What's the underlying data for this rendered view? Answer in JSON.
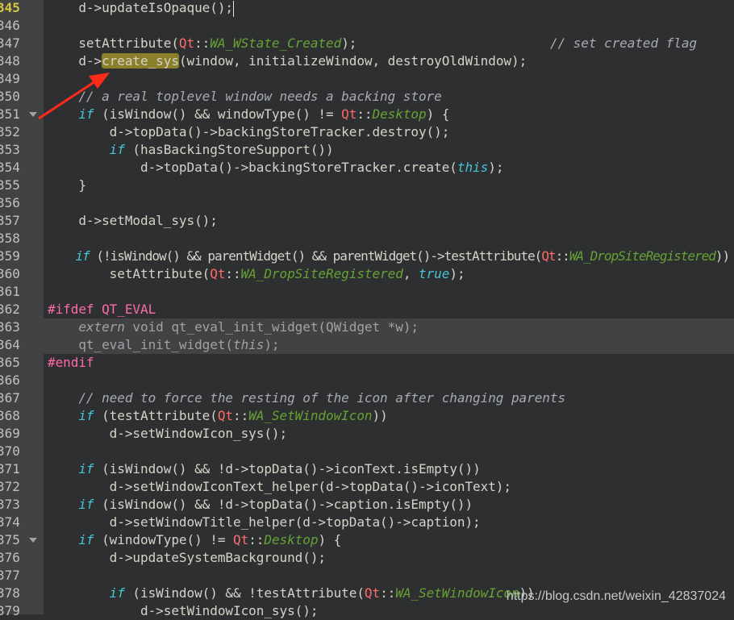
{
  "editor": {
    "current_line": 345,
    "colors": {
      "background": "#2e2f30",
      "gutter": "#404244",
      "keyword": "#45c6d6",
      "qt_namespace": "#ff6a6a",
      "enum": "#66a334",
      "comment": "#a8abb0",
      "preprocessor": "#ff6aad",
      "search_highlight": "#8a7f2a",
      "annotation_arrow": "#ff2a1a"
    },
    "lines": [
      {
        "n": "345",
        "segs": [
          [
            "",
            "    d->updateIsOpaque();"
          ]
        ],
        "cursor": true
      },
      {
        "n": "346",
        "segs": []
      },
      {
        "n": "347",
        "segs": [
          [
            "",
            "    setAttribute("
          ],
          [
            "qt",
            "Qt"
          ],
          [
            "",
            "::"
          ],
          [
            "enum",
            "WA_WState_Created"
          ],
          [
            "",
            ");                         "
          ],
          [
            "cm",
            "// set created flag"
          ]
        ]
      },
      {
        "n": "348",
        "segs": [
          [
            "",
            "    d->"
          ],
          [
            "hl",
            "create_sys"
          ],
          [
            "",
            "(window, initializeWindow, destroyOldWindow);"
          ]
        ]
      },
      {
        "n": "349",
        "segs": []
      },
      {
        "n": "350",
        "segs": [
          [
            "cm",
            "    // a real toplevel window needs a backing store"
          ]
        ]
      },
      {
        "n": "351",
        "fold": true,
        "segs": [
          [
            "",
            "    "
          ],
          [
            "kw",
            "if"
          ],
          [
            "",
            " (isWindow() && windowType() != "
          ],
          [
            "qt",
            "Qt"
          ],
          [
            "",
            "::"
          ],
          [
            "enum",
            "Desktop"
          ],
          [
            "",
            ") {"
          ]
        ]
      },
      {
        "n": "352",
        "segs": [
          [
            "",
            "        d->topData()->backingStoreTracker.destroy();"
          ]
        ]
      },
      {
        "n": "353",
        "segs": [
          [
            "",
            "        "
          ],
          [
            "kw",
            "if"
          ],
          [
            "",
            " (hasBackingStoreSupport())"
          ]
        ]
      },
      {
        "n": "354",
        "segs": [
          [
            "",
            "            d->topData()->backingStoreTracker.create("
          ],
          [
            "kw",
            "this"
          ],
          [
            "",
            ");"
          ]
        ]
      },
      {
        "n": "355",
        "segs": [
          [
            "",
            "    }"
          ]
        ]
      },
      {
        "n": "356",
        "segs": []
      },
      {
        "n": "357",
        "segs": [
          [
            "",
            "    d->setModal_sys();"
          ]
        ]
      },
      {
        "n": "358",
        "segs": []
      },
      {
        "n": "359",
        "segs": [
          [
            "",
            "    "
          ],
          [
            "kw",
            "if"
          ],
          [
            "",
            " (!isWindow() && parentWidget() && parentWidget()->testAttribute("
          ],
          [
            "qt",
            "Qt"
          ],
          [
            "",
            "::"
          ],
          [
            "enum",
            "WA_DropSiteRegistered"
          ],
          [
            "",
            "))"
          ]
        ]
      },
      {
        "n": "360",
        "segs": [
          [
            "",
            "        setAttribute("
          ],
          [
            "qt",
            "Qt"
          ],
          [
            "",
            "::"
          ],
          [
            "enum",
            "WA_DropSiteRegistered"
          ],
          [
            "",
            ", "
          ],
          [
            "lit",
            "true"
          ],
          [
            "",
            ");"
          ]
        ]
      },
      {
        "n": "361",
        "segs": []
      },
      {
        "n": "362",
        "segs": [
          [
            "pp",
            "#ifdef QT_EVAL"
          ]
        ]
      },
      {
        "n": "363",
        "band": true,
        "segs": [
          [
            "dis",
            "    "
          ],
          [
            "disi",
            "extern"
          ],
          [
            "dis",
            " void qt_eval_init_widget(QWidget *w);"
          ]
        ]
      },
      {
        "n": "364",
        "band": true,
        "segs": [
          [
            "dis",
            "    qt_eval_init_widget("
          ],
          [
            "disi",
            "this"
          ],
          [
            "dis",
            ");"
          ]
        ]
      },
      {
        "n": "365",
        "segs": [
          [
            "pp",
            "#endif"
          ]
        ]
      },
      {
        "n": "366",
        "segs": []
      },
      {
        "n": "367",
        "segs": [
          [
            "cm",
            "    // need to force the resting of the icon after changing parents"
          ]
        ]
      },
      {
        "n": "368",
        "segs": [
          [
            "",
            "    "
          ],
          [
            "kw",
            "if"
          ],
          [
            "",
            " (testAttribute("
          ],
          [
            "qt",
            "Qt"
          ],
          [
            "",
            "::"
          ],
          [
            "enum",
            "WA_SetWindowIcon"
          ],
          [
            "",
            "))"
          ]
        ]
      },
      {
        "n": "369",
        "segs": [
          [
            "",
            "        d->setWindowIcon_sys();"
          ]
        ]
      },
      {
        "n": "370",
        "segs": []
      },
      {
        "n": "371",
        "segs": [
          [
            "",
            "    "
          ],
          [
            "kw",
            "if"
          ],
          [
            "",
            " (isWindow() && !d->topData()->iconText.isEmpty())"
          ]
        ]
      },
      {
        "n": "372",
        "segs": [
          [
            "",
            "        d->setWindowIconText_helper(d->topData()->iconText);"
          ]
        ]
      },
      {
        "n": "373",
        "segs": [
          [
            "",
            "    "
          ],
          [
            "kw",
            "if"
          ],
          [
            "",
            " (isWindow() && !d->topData()->caption.isEmpty())"
          ]
        ]
      },
      {
        "n": "374",
        "segs": [
          [
            "",
            "        d->setWindowTitle_helper(d->topData()->caption);"
          ]
        ]
      },
      {
        "n": "375",
        "fold": true,
        "segs": [
          [
            "",
            "    "
          ],
          [
            "kw",
            "if"
          ],
          [
            "",
            " (windowType() != "
          ],
          [
            "qt",
            "Qt"
          ],
          [
            "",
            "::"
          ],
          [
            "enum",
            "Desktop"
          ],
          [
            "",
            ") {"
          ]
        ]
      },
      {
        "n": "376",
        "segs": [
          [
            "",
            "        d->updateSystemBackground();"
          ]
        ]
      },
      {
        "n": "377",
        "segs": []
      },
      {
        "n": "378",
        "segs": [
          [
            "",
            "        "
          ],
          [
            "kw",
            "if"
          ],
          [
            "",
            " (isWindow() && !testAttribute("
          ],
          [
            "qt",
            "Qt"
          ],
          [
            "",
            "::"
          ],
          [
            "enum",
            "WA_SetWindowIcon"
          ],
          [
            "",
            "))"
          ]
        ]
      },
      {
        "n": "379",
        "segs": [
          [
            "",
            "            d->setWindowIcon_sys();"
          ]
        ]
      }
    ]
  },
  "watermark": "https://blog.csdn.net/weixin_42837024"
}
